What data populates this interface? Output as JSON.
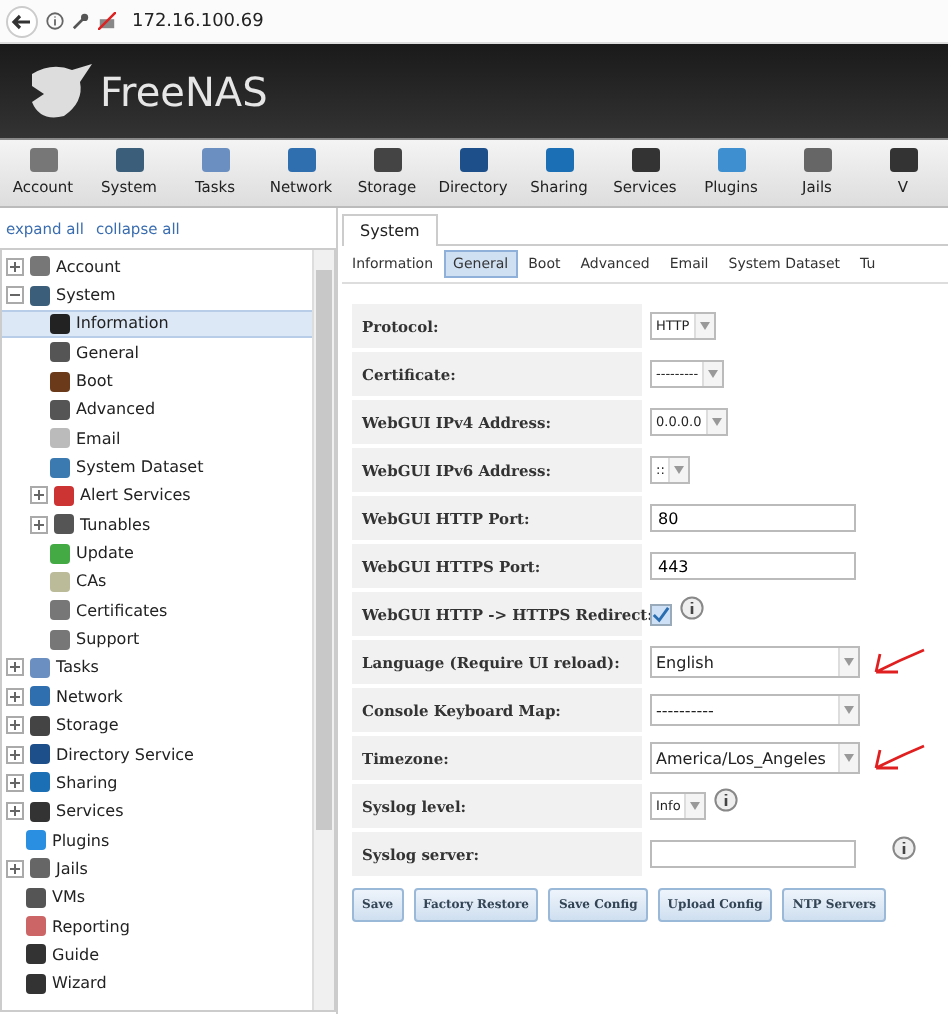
{
  "browser": {
    "address": "172.16.100.69"
  },
  "header": {
    "logo": "FreeNAS"
  },
  "toolbar": [
    "Account",
    "System",
    "Tasks",
    "Network",
    "Storage",
    "Directory",
    "Sharing",
    "Services",
    "Plugins",
    "Jails",
    "V"
  ],
  "tree_links": [
    "expand all",
    "collapse all"
  ],
  "tree": [
    {
      "label": "Account",
      "expanded": false,
      "selected": false
    },
    {
      "label": "System",
      "expanded": true,
      "selected": false,
      "children": [
        {
          "label": "Information",
          "selected": true
        },
        {
          "label": "General",
          "selected": false
        },
        {
          "label": "Boot",
          "selected": false
        },
        {
          "label": "Advanced",
          "selected": false
        },
        {
          "label": "Email",
          "selected": false
        },
        {
          "label": "System Dataset",
          "selected": false
        },
        {
          "label": "Alert Services",
          "expanded": false,
          "selected": false
        },
        {
          "label": "Tunables",
          "expanded": false,
          "selected": false
        },
        {
          "label": "Update",
          "selected": false
        },
        {
          "label": "CAs",
          "selected": false
        },
        {
          "label": "Certificates",
          "selected": false
        },
        {
          "label": "Support",
          "selected": false
        }
      ]
    },
    {
      "label": "Tasks",
      "expanded": false,
      "selected": false
    },
    {
      "label": "Network",
      "expanded": false,
      "selected": false
    },
    {
      "label": "Storage",
      "expanded": false,
      "selected": false
    },
    {
      "label": "Directory Service",
      "expanded": false,
      "selected": false
    },
    {
      "label": "Sharing",
      "expanded": false,
      "selected": false
    },
    {
      "label": "Services",
      "expanded": false,
      "selected": false
    },
    {
      "label": "Plugins",
      "selected": false
    },
    {
      "label": "Jails",
      "expanded": false,
      "selected": false
    },
    {
      "label": "VMs",
      "selected": false
    },
    {
      "label": "Reporting",
      "selected": false
    },
    {
      "label": "Guide",
      "selected": false
    },
    {
      "label": "Wizard",
      "selected": false
    }
  ],
  "main_tab": "System",
  "tabs": [
    {
      "label": "Information",
      "selected": false
    },
    {
      "label": "General",
      "selected": true
    },
    {
      "label": "Boot",
      "selected": false
    },
    {
      "label": "Advanced",
      "selected": false
    },
    {
      "label": "Email",
      "selected": false
    },
    {
      "label": "System Dataset",
      "selected": false
    },
    {
      "label": "Tu",
      "selected": false
    }
  ],
  "fields": [
    {
      "label": "Protocol:",
      "kind": "select",
      "value": "HTTP",
      "help": false,
      "annotated": false
    },
    {
      "label": "Certificate:",
      "kind": "select",
      "value": "---------",
      "help": false,
      "annotated": false
    },
    {
      "label": "WebGUI IPv4 Address:",
      "kind": "select",
      "value": "0.0.0.0",
      "help": false,
      "annotated": false
    },
    {
      "label": "WebGUI IPv6 Address:",
      "kind": "select",
      "value": "::",
      "help": false,
      "annotated": false
    },
    {
      "label": "WebGUI HTTP Port:",
      "kind": "text",
      "value": "80",
      "help": false,
      "annotated": false
    },
    {
      "label": "WebGUI HTTPS Port:",
      "kind": "text",
      "value": "443",
      "help": false,
      "annotated": false
    },
    {
      "label": "WebGUI HTTP -> HTTPS Redirect:",
      "kind": "checkbox",
      "checked": true,
      "help": true,
      "annotated": false
    },
    {
      "label": "Language (Require UI reload):",
      "kind": "combo",
      "value": "English",
      "help": false,
      "annotated": true
    },
    {
      "label": "Console Keyboard Map:",
      "kind": "combo",
      "value": "----------",
      "help": false,
      "annotated": false
    },
    {
      "label": "Timezone:",
      "kind": "combo",
      "value": "America/Los_Angeles",
      "help": false,
      "annotated": true
    },
    {
      "label": "Syslog level:",
      "kind": "select",
      "value": "Info",
      "help": true,
      "annotated": false
    },
    {
      "label": "Syslog server:",
      "kind": "text",
      "help": true,
      "annotated": false
    }
  ],
  "buttons": [
    "Save",
    "Factory Restore",
    "Save Config",
    "Upload Config",
    "NTP Servers"
  ]
}
